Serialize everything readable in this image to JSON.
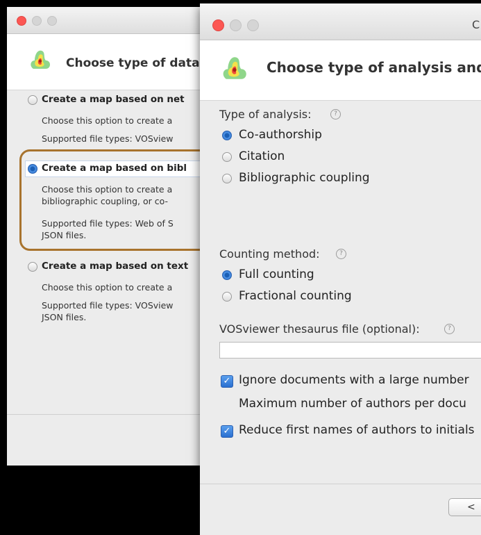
{
  "window1": {
    "header_title": "Choose type of data",
    "options": [
      {
        "title": "Create a map based on net",
        "desc": [
          "Choose this option to create a"
        ],
        "filetypes": [
          "Supported file types: VOSview"
        ],
        "selected": false
      },
      {
        "title": "Create a map based on bibl",
        "desc": [
          "Choose this option to create a",
          "bibliographic coupling, or co-"
        ],
        "filetypes": [
          "Supported file types: Web of S",
          "JSON files."
        ],
        "selected": true
      },
      {
        "title": "Create a map based on text",
        "desc": [
          "Choose this option to create a"
        ],
        "filetypes": [
          "Supported file types: VOSview",
          "JSON files."
        ],
        "selected": false
      }
    ]
  },
  "window2": {
    "title": "C",
    "header_title": "Choose type of analysis and",
    "analysis_label": "Type of analysis:",
    "analysis_options": [
      {
        "label": "Co-authorship",
        "selected": true
      },
      {
        "label": "Citation",
        "selected": false
      },
      {
        "label": "Bibliographic coupling",
        "selected": false
      }
    ],
    "counting_label": "Counting method:",
    "counting_options": [
      {
        "label": "Full counting",
        "selected": true
      },
      {
        "label": "Fractional counting",
        "selected": false
      }
    ],
    "thesaurus_label": "VOSviewer thesaurus file (optional):",
    "thesaurus_value": "",
    "ignore_label": "Ignore documents with a large number",
    "ignore_checked": true,
    "max_authors_label": "Maximum number of authors per docu",
    "reduce_label": "Reduce first names of authors to initials",
    "reduce_checked": true,
    "back_button": "<",
    "help_glyph": "?"
  }
}
